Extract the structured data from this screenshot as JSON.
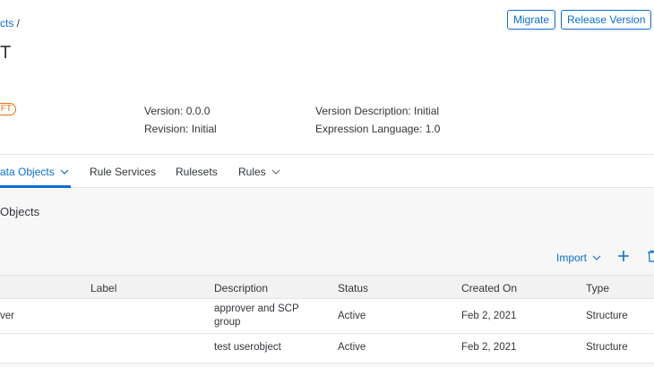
{
  "header": {
    "breadcrumb": {
      "link": "cts",
      "separator": " /"
    },
    "title": "T",
    "actions": {
      "migrate": "Migrate",
      "release_version": "Release Version"
    },
    "status": "FT",
    "meta": {
      "version": "Version: 0.0.0",
      "revision": "Revision: Initial",
      "version_description": "Version Description: Initial",
      "expression_language": "Expression Language: 1.0"
    }
  },
  "tabs": [
    {
      "label": "ata Objects",
      "has_menu": true,
      "active": true
    },
    {
      "label": "Rule Services",
      "has_menu": false
    },
    {
      "label": "Rulesets",
      "has_menu": false
    },
    {
      "label": "Rules",
      "has_menu": true
    }
  ],
  "section": {
    "title": "Objects",
    "toolbar": {
      "import": "Import"
    }
  },
  "table": {
    "columns": [
      "Label",
      "Description",
      "Status",
      "Created On",
      "Type"
    ],
    "rows": [
      {
        "name": "ver",
        "label": "",
        "description_line1": "approver and SCP",
        "description_line2": "group",
        "status": "Active",
        "created_on": "Feb 2, 2021",
        "type": "Structure"
      },
      {
        "name": "",
        "label": "",
        "description_line1": "test userobject",
        "description_line2": "",
        "status": "Active",
        "created_on": "Feb 2, 2021",
        "type": "Structure"
      }
    ]
  },
  "colors": {
    "accent": "#0a6ed1",
    "draft": "#e9730c"
  }
}
